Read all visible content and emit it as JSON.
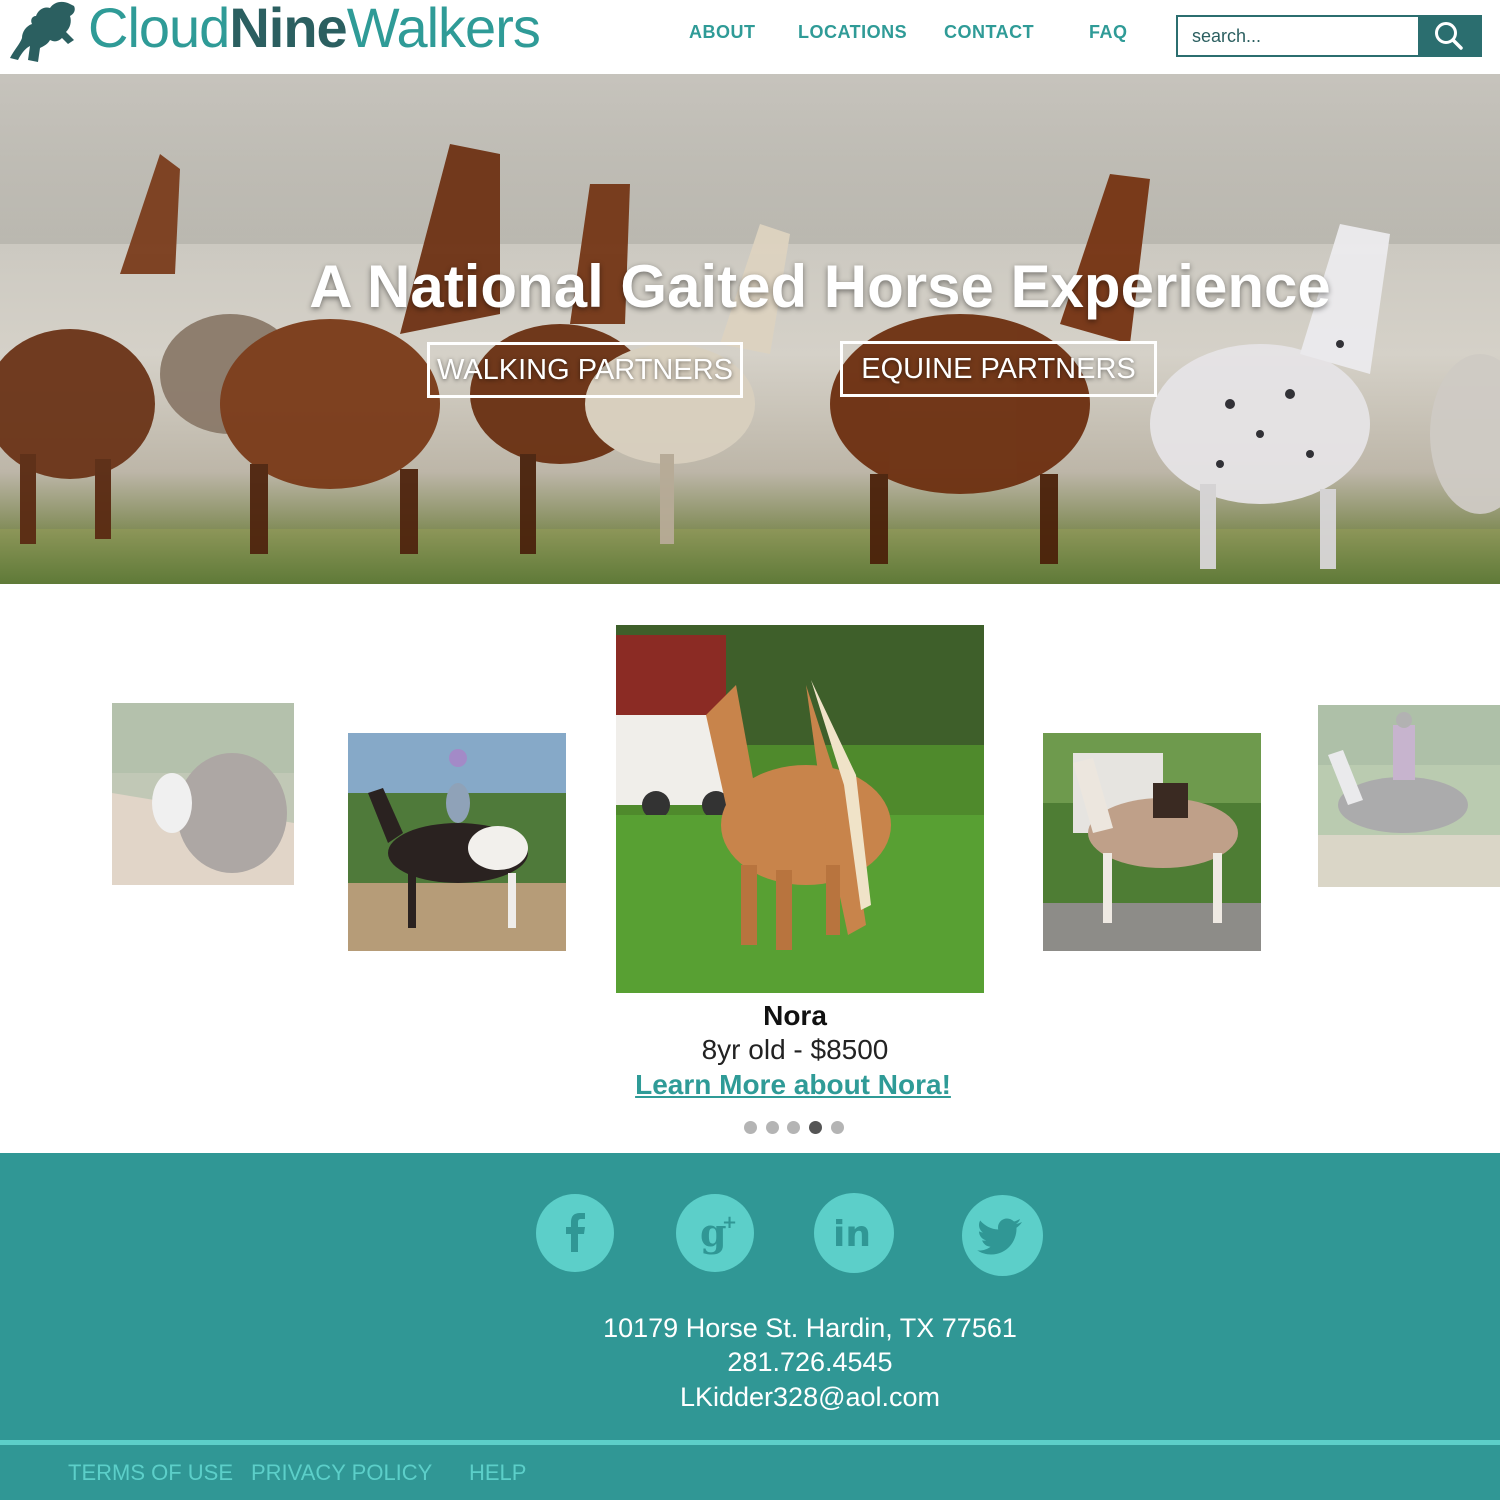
{
  "brand": {
    "name_part1": "Cloud",
    "name_part2": "Nine",
    "name_part3": "Walkers",
    "logo_icon": "rearing-horse-icon",
    "primary_color": "#2f9b97",
    "dark_color": "#2b5f60"
  },
  "nav": {
    "items": [
      {
        "label": "ABOUT"
      },
      {
        "label": "LOCATIONS"
      },
      {
        "label": "CONTACT"
      },
      {
        "label": "FAQ"
      }
    ]
  },
  "search": {
    "placeholder": "search...",
    "icon": "search-icon"
  },
  "hero": {
    "title": "A National Gaited Horse Experience",
    "buttons": [
      {
        "label": "WALKING PARTNERS"
      },
      {
        "label": "EQUINE PARTNERS"
      }
    ]
  },
  "carousel": {
    "featured": {
      "name": "Nora",
      "info": "8yr old - $8500",
      "link": "Learn More about Nora!"
    },
    "dot_count": 5,
    "active_dot": 4
  },
  "footer": {
    "background": "#309795",
    "accent": "#5ccfc9",
    "social": [
      {
        "icon": "facebook-icon"
      },
      {
        "icon": "google-plus-icon"
      },
      {
        "icon": "linkedin-icon"
      },
      {
        "icon": "twitter-icon"
      }
    ],
    "address": "10179 Horse St. Hardin, TX 77561",
    "phone": "281.726.4545",
    "email": "LKidder328@aol.com",
    "links": [
      {
        "label": "TERMS OF USE"
      },
      {
        "label": "PRIVACY POLICY"
      },
      {
        "label": "HELP"
      }
    ]
  }
}
